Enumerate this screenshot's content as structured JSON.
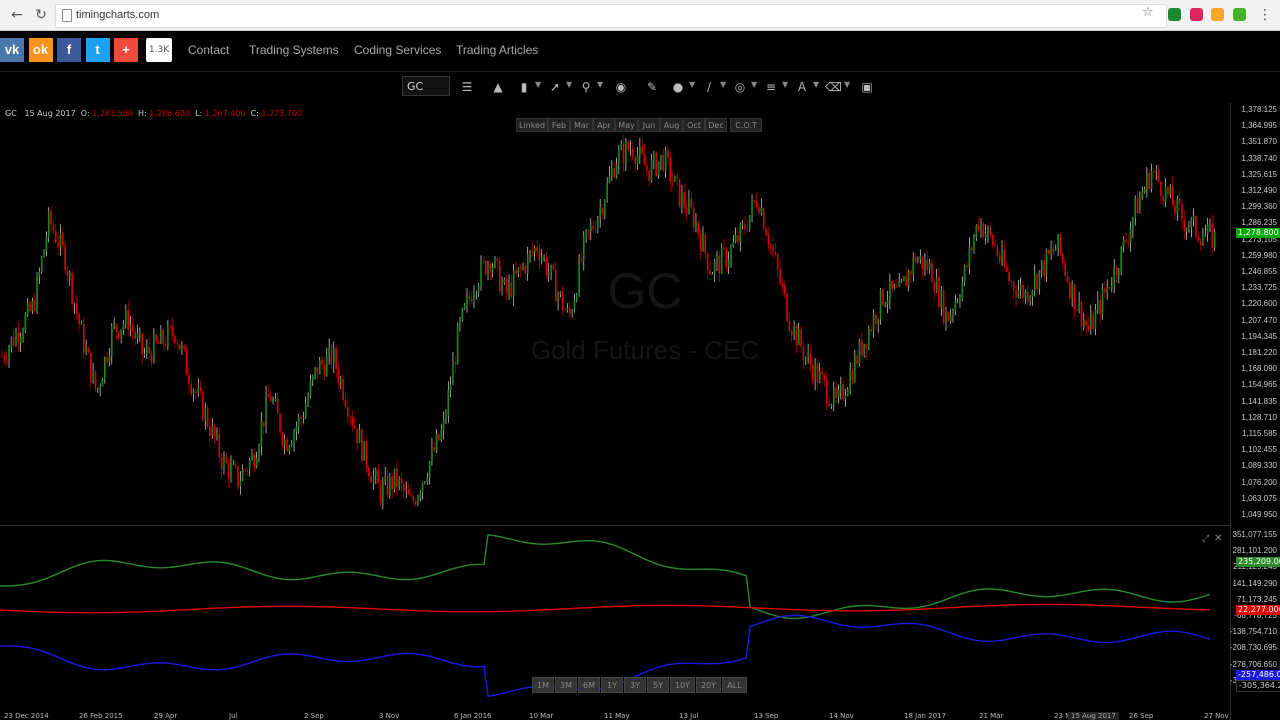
{
  "browser": {
    "back_icon": "back-arrow-icon",
    "reload_icon": "reload-icon",
    "url": "timingcharts.com"
  },
  "site_nav": {
    "share_count": "1.3K",
    "links": [
      "Contact",
      "Trading Systems",
      "Coding Services",
      "Trading Articles"
    ],
    "social": [
      {
        "name": "vk",
        "label": "vk",
        "color": "#4a76a8"
      },
      {
        "name": "odnoklassniki",
        "label": "ok",
        "color": "#f7931e"
      },
      {
        "name": "facebook",
        "label": "f",
        "color": "#3b5998"
      },
      {
        "name": "twitter",
        "label": "t",
        "color": "#1da1f2"
      },
      {
        "name": "share-plus",
        "label": "+",
        "color": "#f04a3a"
      }
    ]
  },
  "toolbar": {
    "symbol": "GC"
  },
  "chart_header": {
    "symbol": "GC",
    "date": "15 Aug 2017",
    "o_label": "O:",
    "o_value": "1,283.500",
    "h_label": "H:",
    "h_value": "1,286.600",
    "l_label": "L:",
    "l_value": "1,267.400",
    "c_label": "C:",
    "c_value": "1,273.700"
  },
  "month_buttons": [
    "Linked",
    "Feb",
    "Mar",
    "Apr",
    "May",
    "Jun",
    "Aug",
    "Oct",
    "Dec",
    "C.O.T"
  ],
  "watermark": {
    "symbol": "GC",
    "name": "Gold Futures - CEC"
  },
  "y_ticks": [
    "1,378.125",
    "1,364.995",
    "1,351.870",
    "1,338.740",
    "1,325.615",
    "1,312.490",
    "1,299.360",
    "1,286.235",
    "1,273.105",
    "1,259.980",
    "1,246.855",
    "1,233.725",
    "1,220.600",
    "1,207.470",
    "1,194.345",
    "1,181.220",
    "1,168.090",
    "1,154.965",
    "1,141.835",
    "1,128.710",
    "1,115.585",
    "1,102.455",
    "1,089.330",
    "1,076.200",
    "1,063.075",
    "1,049.950"
  ],
  "last_price": "1,278.800",
  "cot_ticks": [
    "351,077.155",
    "281,101.200",
    "211,125.245",
    "141,149.290",
    "71,173.245",
    "-68,778.725",
    "-138,754.710",
    "-208,730.695",
    "-278,706.650",
    "-348,682.600"
  ],
  "cot_labels": {
    "green": "235,209.000",
    "red": "22,277.000",
    "blue": "-257,486.000",
    "blue2": "-305,364.204"
  },
  "range_buttons": [
    "1M",
    "3M",
    "6M",
    "1Y",
    "3Y",
    "5Y",
    "10Y",
    "20Y",
    "ALL"
  ],
  "x_ticks": [
    "23 Dec 2014",
    "26 Feb 2015",
    "29 Apr",
    "Jul",
    "2 Sep",
    "3 Nov",
    "6 Jan 2016",
    "10 Mar",
    "11 May",
    "13 Jul",
    "13 Sep",
    "14 Nov",
    "18 Jan 2017",
    "21 Mar",
    "23 May",
    "26 Sep",
    "27 Nov"
  ],
  "cursor_date": "15 Aug 2017",
  "colors": {
    "up": "#1a8a1a",
    "down": "#e00000",
    "cot_green": "#2a8a2a",
    "cot_red": "#e00000",
    "cot_blue": "#1a1ae0"
  },
  "chart_data": [
    {
      "type": "candlestick",
      "series": [
        {
          "name": "GC"
        }
      ],
      "x_range": [
        "23 Dec 2014",
        "27 Nov 2017"
      ],
      "ylim": [
        1049.95,
        1378.125
      ],
      "close": [
        1180,
        1200,
        1220,
        1290,
        1260,
        1200,
        1150,
        1200,
        1210,
        1180,
        1190,
        1200,
        1160,
        1130,
        1095,
        1080,
        1100,
        1150,
        1110,
        1130,
        1170,
        1180,
        1140,
        1100,
        1070,
        1080,
        1060,
        1090,
        1120,
        1200,
        1240,
        1260,
        1230,
        1250,
        1270,
        1240,
        1210,
        1270,
        1300,
        1340,
        1350,
        1330,
        1340,
        1310,
        1290,
        1250,
        1260,
        1280,
        1310,
        1260,
        1210,
        1180,
        1160,
        1140,
        1170,
        1200,
        1230,
        1230,
        1260,
        1250,
        1210,
        1240,
        1290,
        1270,
        1240,
        1230,
        1250,
        1270,
        1230,
        1200,
        1230,
        1260,
        1300,
        1330,
        1310,
        1290,
        1280,
        1275
      ],
      "grid": false
    },
    {
      "type": "line",
      "title": "C.O.T",
      "series": [
        {
          "name": "green"
        },
        {
          "name": "red"
        },
        {
          "name": "blue"
        }
      ],
      "ylim": [
        -348682.6,
        351077.155
      ]
    }
  ]
}
